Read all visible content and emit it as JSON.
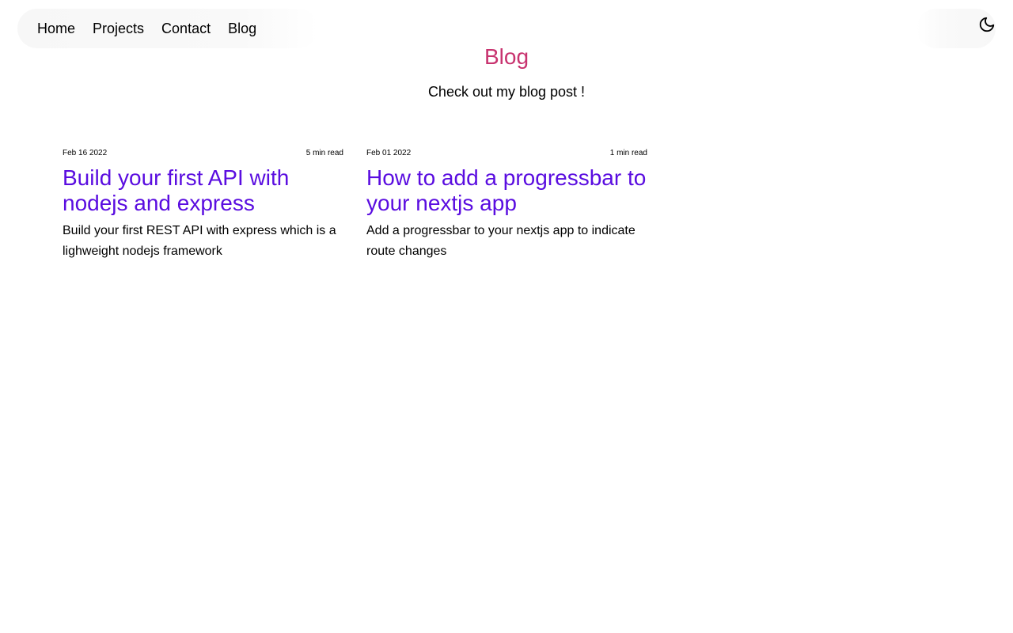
{
  "nav": {
    "items": [
      {
        "label": "Home"
      },
      {
        "label": "Projects"
      },
      {
        "label": "Contact"
      },
      {
        "label": "Blog"
      }
    ],
    "theme_toggle_icon": "moon-icon"
  },
  "header": {
    "title": "Blog",
    "subtitle": "Check out my blog post !"
  },
  "posts": [
    {
      "date": "Feb 16 2022",
      "read_time": "5 min read",
      "title": "Build your first API with nodejs and express",
      "description": "Build your first REST API with express which is a lighweight nodejs framework"
    },
    {
      "date": "Feb 01 2022",
      "read_time": "1 min read",
      "title": "How to add a progressbar to your nextjs app",
      "description": "Add a progressbar to your nextjs app to indicate route changes"
    }
  ],
  "colors": {
    "title_accent": "#c8336f",
    "post_title": "#5a0de0"
  }
}
